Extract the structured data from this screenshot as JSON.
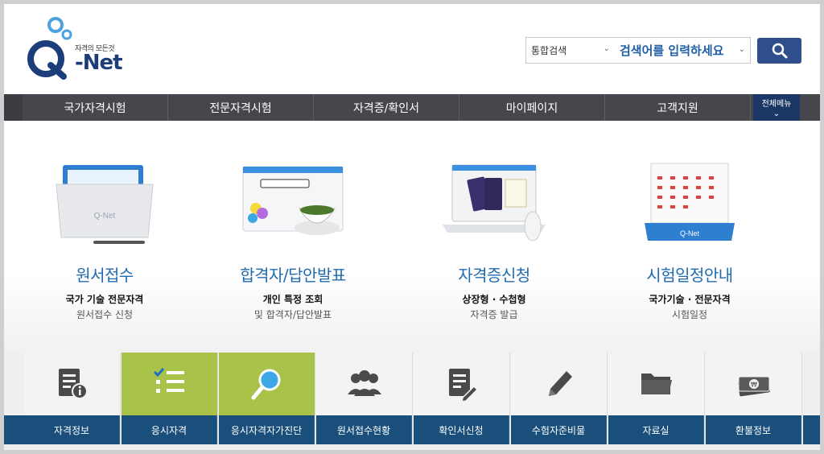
{
  "header": {
    "logo_tagline": "자격의 모든것",
    "logo_text": "-Net",
    "search_category": "통합검색",
    "search_placeholder": "검색어를 입력하세요"
  },
  "nav": {
    "items": [
      "국가자격시험",
      "전문자격시험",
      "자격증/확인서",
      "마이페이지",
      "고객지원"
    ],
    "all_menu": "전체메뉴"
  },
  "tiles": [
    {
      "title": "원서접수",
      "sub1": "국가 기술 전문자격",
      "sub2": "원서접수 신청",
      "icon": "folder-illustration"
    },
    {
      "title": "합격자/답안발표",
      "sub1": "개인 특정 조회",
      "sub2": "및 합격자/답안발표",
      "icon": "browser-balloon-illustration"
    },
    {
      "title": "자격증신청",
      "sub1": "상장형 · 수첩형",
      "sub2": "자격증 발급",
      "icon": "laptop-passport-illustration"
    },
    {
      "title": "시험일정안내",
      "sub1": "국가기술 · 전문자격",
      "sub2": "시험일정",
      "icon": "calendar-illustration"
    }
  ],
  "quick_menu": [
    {
      "label": "자격정보",
      "icon": "info-document-icon"
    },
    {
      "label": "응시자격",
      "icon": "checklist-icon"
    },
    {
      "label": "응시자격자가진단",
      "icon": "magnifier-icon"
    },
    {
      "label": "원서접수현황",
      "icon": "people-icon"
    },
    {
      "label": "확인서신청",
      "icon": "document-edit-icon"
    },
    {
      "label": "수험자준비물",
      "icon": "pencil-icon"
    },
    {
      "label": "자료실",
      "icon": "folder-icon"
    },
    {
      "label": "환불정보",
      "icon": "money-icon"
    }
  ],
  "colors": {
    "nav_bg": "#46474d",
    "all_menu_bg": "#1a3766",
    "tile_title": "#1f6bb0",
    "quick_label_bg": "#1b4f7b",
    "quick_active": "#a8c24a",
    "search_button": "#2e4f8c"
  }
}
